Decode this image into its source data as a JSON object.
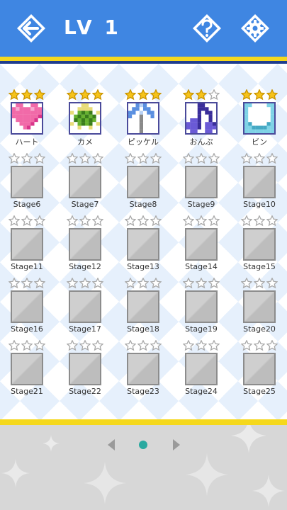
{
  "header": {
    "title": "LV 1",
    "back_icon": "back-arrow-icon",
    "help_icon": "question-icon",
    "settings_icon": "gear-icon"
  },
  "colors": {
    "header_bg": "#3f86e2",
    "accent_yellow": "#f5d81c",
    "accent_navy": "#1f3d8f",
    "star_gold": "#f6c31a",
    "star_gray": "#a9a9a9",
    "page_dot": "#2aa9a0"
  },
  "stages": [
    {
      "label": "ハート",
      "stars": 3,
      "locked": false,
      "art": "heart"
    },
    {
      "label": "カメ",
      "stars": 3,
      "locked": false,
      "art": "turtle"
    },
    {
      "label": "ピッケル",
      "stars": 3,
      "locked": false,
      "art": "pickaxe"
    },
    {
      "label": "おんぷ",
      "stars": 2,
      "locked": false,
      "art": "note"
    },
    {
      "label": "ビン",
      "stars": 3,
      "locked": false,
      "art": "bottle"
    },
    {
      "label": "Stage6",
      "stars": 0,
      "locked": true
    },
    {
      "label": "Stage7",
      "stars": 0,
      "locked": true
    },
    {
      "label": "Stage8",
      "stars": 0,
      "locked": true
    },
    {
      "label": "Stage9",
      "stars": 0,
      "locked": true
    },
    {
      "label": "Stage10",
      "stars": 0,
      "locked": true
    },
    {
      "label": "Stage11",
      "stars": 0,
      "locked": true
    },
    {
      "label": "Stage12",
      "stars": 0,
      "locked": true
    },
    {
      "label": "Stage13",
      "stars": 0,
      "locked": true
    },
    {
      "label": "Stage14",
      "stars": 0,
      "locked": true
    },
    {
      "label": "Stage15",
      "stars": 0,
      "locked": true
    },
    {
      "label": "Stage16",
      "stars": 0,
      "locked": true
    },
    {
      "label": "Stage17",
      "stars": 0,
      "locked": true
    },
    {
      "label": "Stage18",
      "stars": 0,
      "locked": true
    },
    {
      "label": "Stage19",
      "stars": 0,
      "locked": true
    },
    {
      "label": "Stage20",
      "stars": 0,
      "locked": true
    },
    {
      "label": "Stage21",
      "stars": 0,
      "locked": true
    },
    {
      "label": "Stage22",
      "stars": 0,
      "locked": true
    },
    {
      "label": "Stage23",
      "stars": 0,
      "locked": true
    },
    {
      "label": "Stage24",
      "stars": 0,
      "locked": true
    },
    {
      "label": "Stage25",
      "stars": 0,
      "locked": true
    }
  ],
  "pagination": {
    "current_page": 1,
    "prev_icon": "left-triangle-icon",
    "next_icon": "right-triangle-icon"
  }
}
